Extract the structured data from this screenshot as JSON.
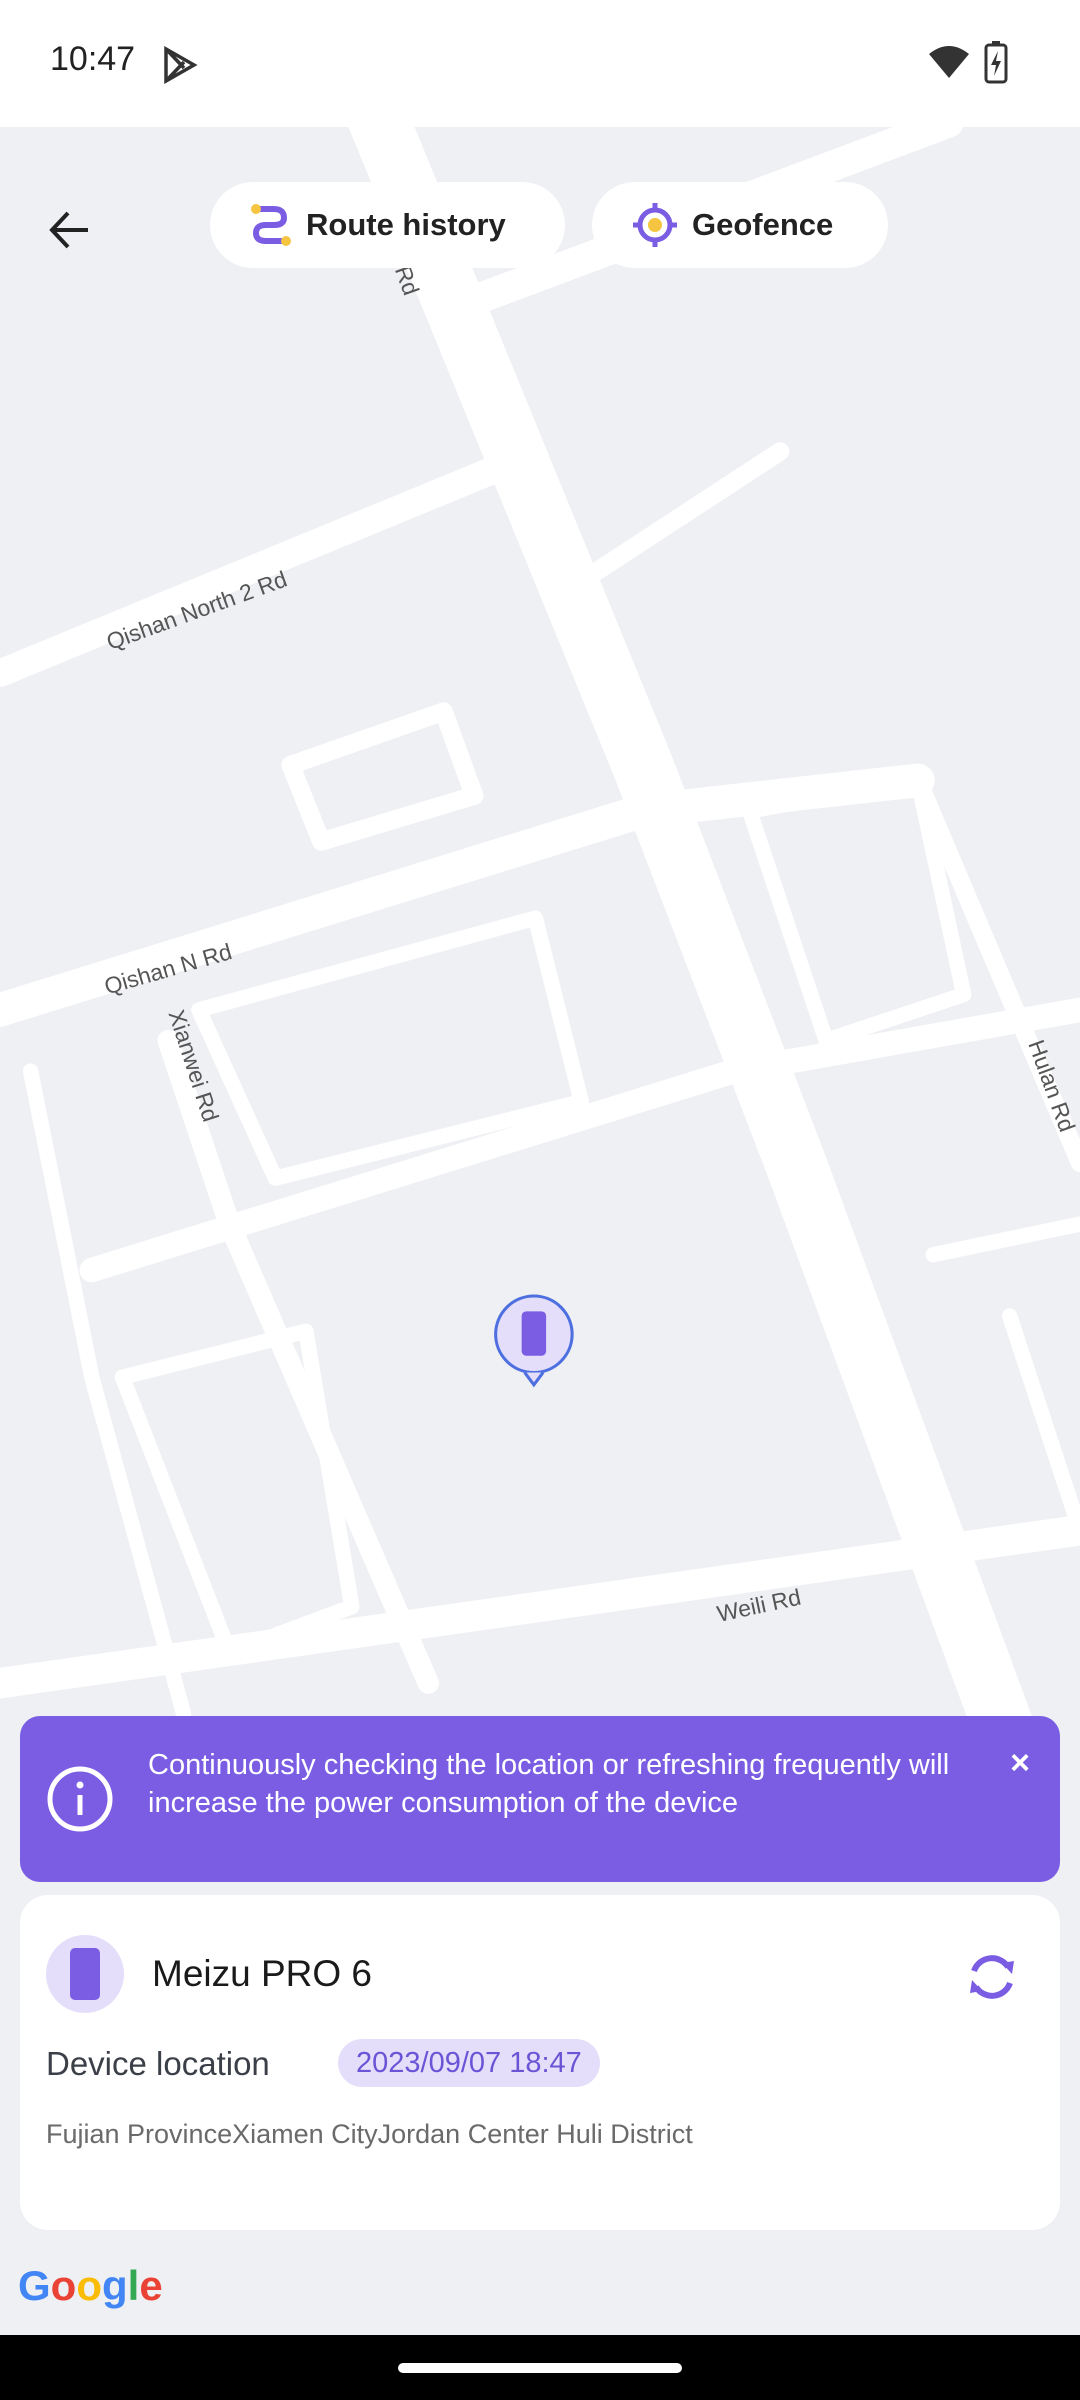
{
  "status_bar": {
    "time": "10:47",
    "icons": [
      "play-store-icon",
      "wifi-icon",
      "battery-charging-icon"
    ]
  },
  "toolbar": {
    "back_icon": "arrow-left-icon",
    "route_history": "Route history",
    "geofence": "Geofence"
  },
  "map": {
    "road_labels": {
      "yun": "Rd",
      "qishan_north_2": "Qishan North 2 Rd",
      "qishan_n": "Qishan N Rd",
      "xianwei": "Xianwei Rd",
      "hulan": "Hulan Rd",
      "weili": "Weili Rd"
    },
    "marker_icon": "phone-icon",
    "attribution": "Google"
  },
  "banner": {
    "message": "Continuously checking the location or refreshing frequently will increase the power consumption of the device",
    "close": "×",
    "color": "#7a5de3"
  },
  "device_card": {
    "name": "Meizu PRO 6",
    "location_label": "Device location",
    "timestamp": "2023/09/07 18:47",
    "address": "Fujian ProvinceXiamen CityJordan Center Huli District"
  },
  "colors": {
    "accent": "#7a5de3",
    "highlight": "#f5c542"
  }
}
